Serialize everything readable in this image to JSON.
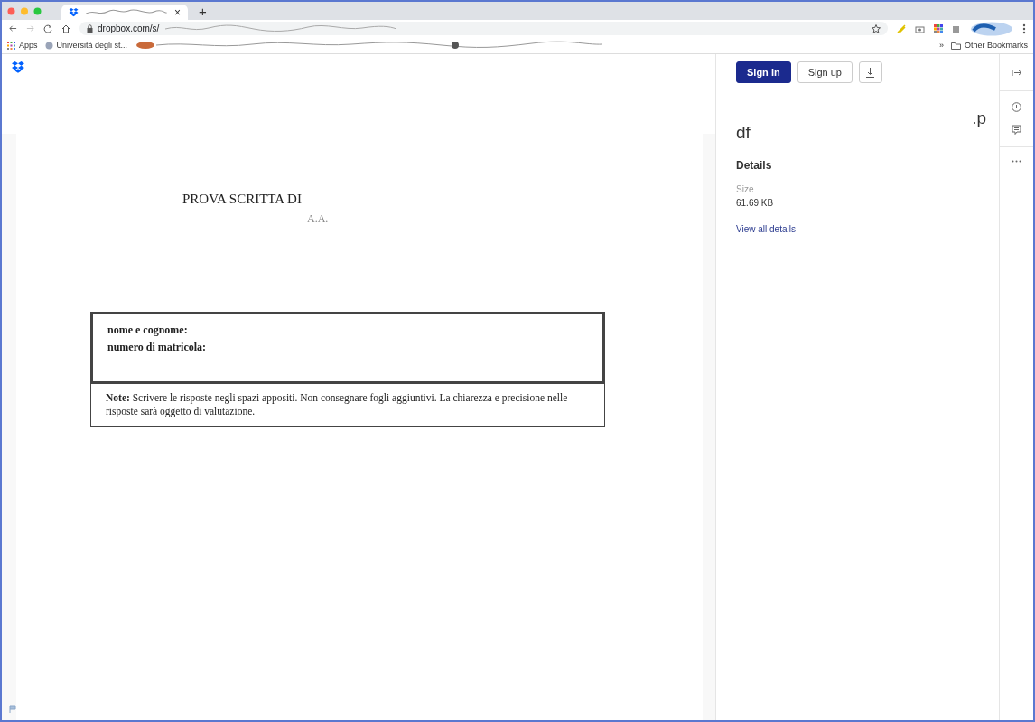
{
  "browser": {
    "tab": {
      "close": "×",
      "new_tab": "+"
    },
    "address": {
      "url": "dropbox.com/s/"
    },
    "bookmarks": [
      {
        "label": "Apps",
        "kind": "apps"
      },
      {
        "label": "Università degli st...",
        "kind": "site"
      }
    ],
    "overflow": "»",
    "other_bookmarks": "Other Bookmarks"
  },
  "document": {
    "title": "PROVA SCRITTA DI",
    "subtitle": "A.A.",
    "fields": [
      "nome e cognome:",
      "numero di matricola:"
    ],
    "note": "**Note:** Scrivere le risposte negli spazi appositi.  Non consegnare fogli aggiuntivi.  La chiarezza e precisione nelle risposte sarà oggetto di valutazione."
  },
  "panel": {
    "buttons": [
      {
        "label": "Sign in",
        "kind": "primary"
      },
      {
        "label": "Sign up",
        "kind": "secondary"
      }
    ],
    "filename_end": ".p",
    "filename_line2": "df",
    "details_heading": "Details",
    "size_label": "Size",
    "size_value": "61.69 KB",
    "link": "View all details"
  }
}
